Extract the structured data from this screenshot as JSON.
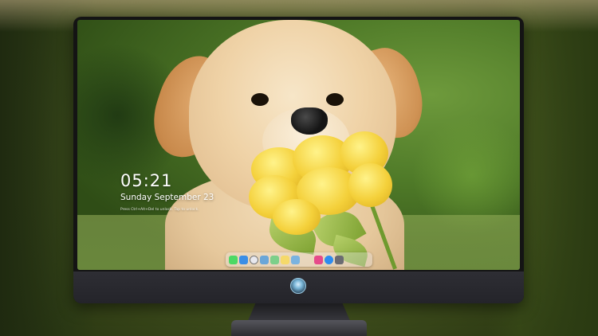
{
  "lock_screen": {
    "time": "05:21",
    "date": "Sunday September 23",
    "hint": "Press Ctrl+Alt+Del to unlock. Tap to unlock."
  },
  "dock": {
    "items": [
      {
        "name": "messages-icon",
        "color": "#4cd964"
      },
      {
        "name": "finder-icon",
        "color": "#3a8ee6"
      },
      {
        "name": "safari-icon",
        "color": "#e8e8ee"
      },
      {
        "name": "preview-icon",
        "color": "#6aa6d8"
      },
      {
        "name": "maps-icon",
        "color": "#7ccf8a"
      },
      {
        "name": "notes-icon",
        "color": "#f5d96a"
      },
      {
        "name": "photos-icon",
        "color": "#7ab3e0"
      },
      {
        "name": "music-icon",
        "color": "#e64a8a"
      },
      {
        "name": "app-store-icon",
        "color": "#2d8cf0"
      },
      {
        "name": "system-preferences-icon",
        "color": "#6b6b72"
      }
    ]
  },
  "colors": {
    "bezel": "#141414",
    "chin": "#2a2a30",
    "text": "#ffffff"
  }
}
